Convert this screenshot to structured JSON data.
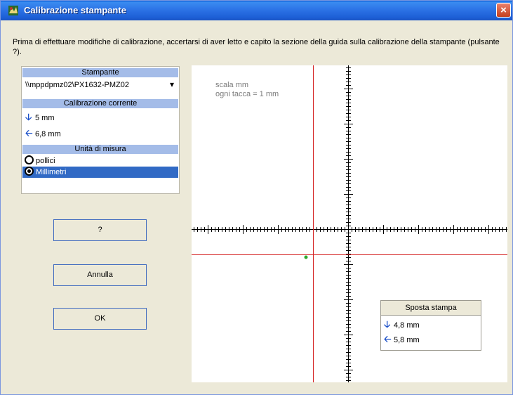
{
  "window": {
    "title": "Calibrazione stampante",
    "close_glyph": "×"
  },
  "intro_text": "Prima di effettuare modifiche di calibrazione, accertarsi di aver letto e capito la sezione della guida sulla calibrazione della stampante (pulsante ?).",
  "printer_section": {
    "header": "Stampante",
    "selected_printer": "\\\\mppdpmz02\\PX1632-PMZ02",
    "dropdown_glyph": "▾"
  },
  "current_calibration": {
    "header": "Calibrazione corrente",
    "vertical": "5 mm",
    "horizontal": "6,8 mm"
  },
  "units": {
    "header": "Unità di misura",
    "options": [
      "pollici",
      "Millimetri"
    ],
    "selected": "Millimetri"
  },
  "buttons": {
    "help": "?",
    "cancel": "Annulla",
    "ok": "OK"
  },
  "canvas": {
    "scale_line1": "scala mm",
    "scale_line2": "ogni tacca = 1 mm",
    "colors": {
      "red_line": "#d42020",
      "dot": "#2ea82e",
      "axis": "#000000"
    }
  },
  "move_print": {
    "header": "Sposta stampa",
    "vertical": "4,8 mm",
    "horizontal": "5,8 mm"
  },
  "icons": {
    "down": "arrow-down-icon",
    "left": "arrow-left-icon"
  }
}
